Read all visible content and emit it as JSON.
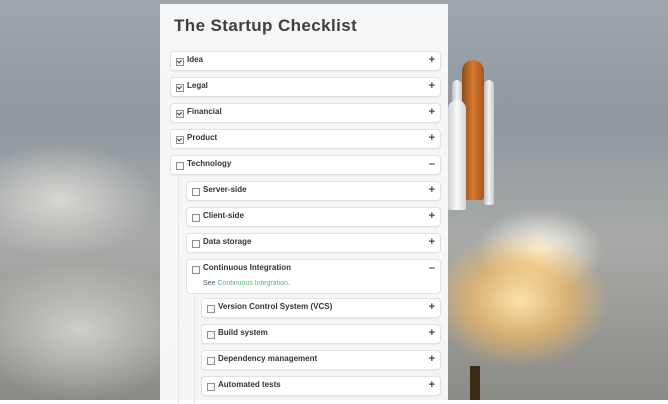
{
  "title": "The Startup Checklist",
  "colors": {
    "link": "#5ab27f",
    "panel": "#ffffff"
  },
  "items": {
    "idea": {
      "label": "Idea",
      "toggle": "+"
    },
    "legal": {
      "label": "Legal",
      "toggle": "+"
    },
    "financial": {
      "label": "Financial",
      "toggle": "+"
    },
    "product": {
      "label": "Product",
      "toggle": "+"
    },
    "technology": {
      "label": "Technology",
      "toggle": "–"
    },
    "server_side": {
      "label": "Server-side",
      "toggle": "+"
    },
    "client_side": {
      "label": "Client-side",
      "toggle": "+"
    },
    "data_storage": {
      "label": "Data storage",
      "toggle": "+"
    },
    "ci": {
      "label": "Continuous Integration",
      "toggle": "–",
      "note_prefix": "See",
      "note_link": "Continuous Integration",
      "note_suffix": "."
    },
    "vcs": {
      "label": "Version Control System (VCS)",
      "toggle": "+"
    },
    "build_system": {
      "label": "Build system",
      "toggle": "+"
    },
    "dependency_mgmt": {
      "label": "Dependency management",
      "toggle": "+"
    },
    "automated_tests": {
      "label": "Automated tests",
      "toggle": "+"
    }
  }
}
